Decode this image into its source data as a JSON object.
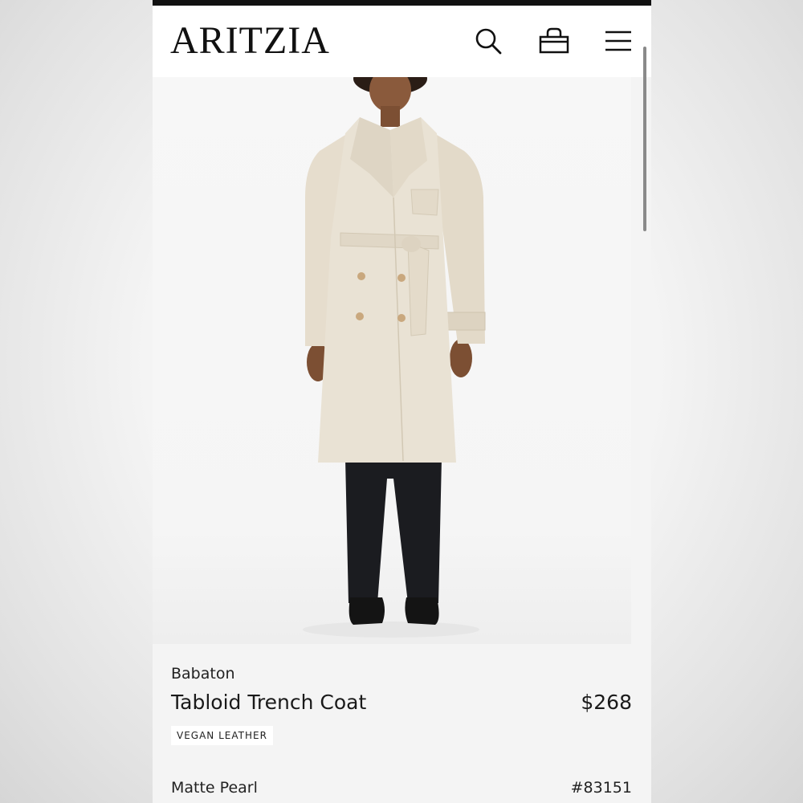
{
  "header": {
    "logo": "ARITZIA",
    "icons": [
      "search-icon",
      "bag-icon",
      "menu-icon"
    ]
  },
  "product": {
    "brand": "Babaton",
    "name": "Tabloid Trench Coat",
    "price": "$268",
    "tag": "VEGAN LEATHER",
    "color_name": "Matte Pearl",
    "sku": "#83151",
    "image": "model-wearing-cream-trench-coat"
  },
  "colors": {
    "coat": "#e9e2d4",
    "pants": "#1b1c20",
    "background": "#f5f5f5"
  }
}
